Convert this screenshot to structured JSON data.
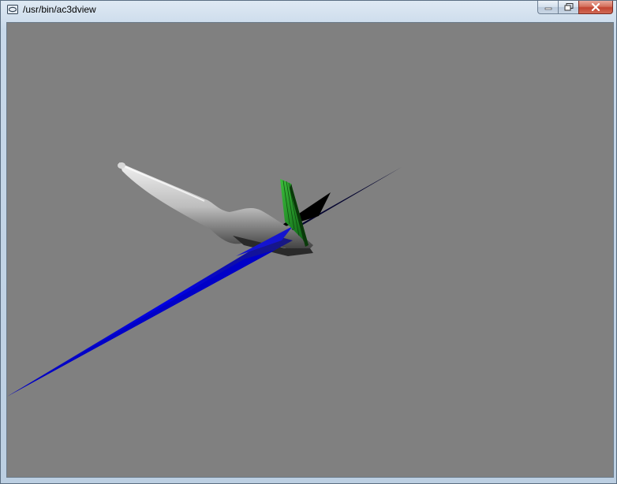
{
  "window": {
    "title": "/usr/bin/ac3dview"
  },
  "icons": {
    "app": "application-icon",
    "minimize": "minimize-icon",
    "maximize": "maximize-icon",
    "close": "close-icon"
  },
  "colors": {
    "viewport_background": "#808080",
    "wing": "#0000d8",
    "fin": "#1f8f1f",
    "fuselage": "#c8c8c8",
    "close_button": "#c7503d"
  }
}
